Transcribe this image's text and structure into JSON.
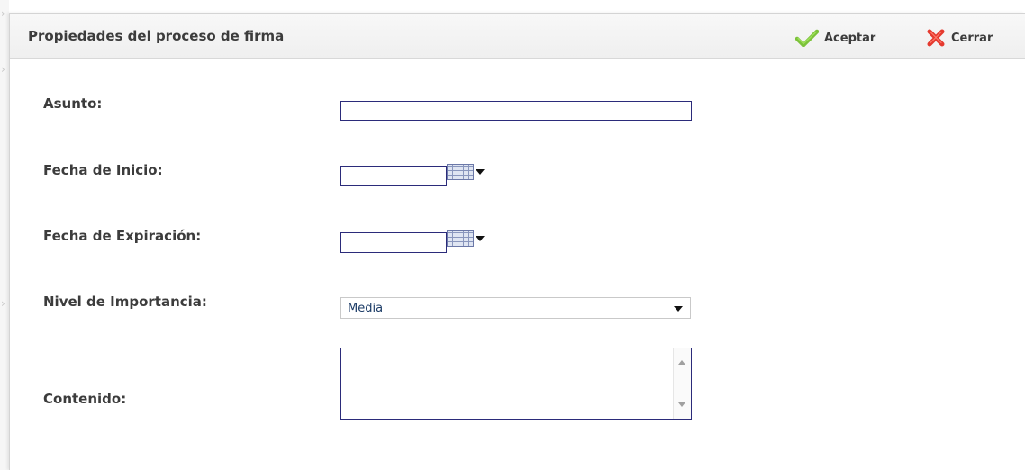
{
  "dialog": {
    "title": "Propiedades del proceso de firma",
    "accept_label": "Aceptar",
    "close_label": "Cerrar",
    "accept_icon": "check-icon",
    "close_icon": "x-icon",
    "accept_color": "#7cc23a",
    "close_color": "#e53a2f"
  },
  "form": {
    "subject": {
      "label": "Asunto:",
      "value": ""
    },
    "start_date": {
      "label": "Fecha de Inicio:",
      "value": ""
    },
    "expiry_date": {
      "label": "Fecha de Expiración:",
      "value": ""
    },
    "importance": {
      "label": "Nivel de Importancia:",
      "selected": "Media"
    },
    "content": {
      "label": "Contenido:",
      "value": ""
    }
  }
}
